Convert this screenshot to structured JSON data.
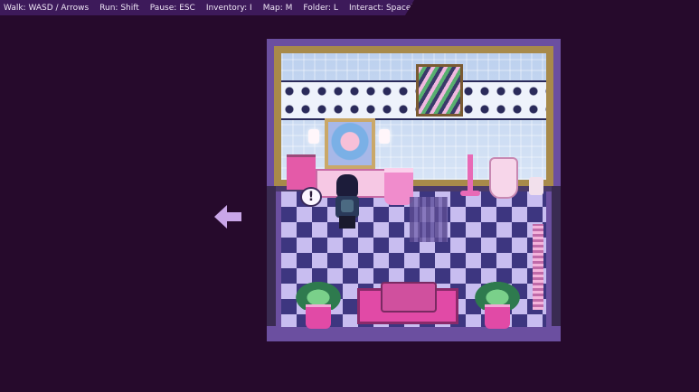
{
  "controls": [
    {
      "label": "Walk: WASD / Arrows"
    },
    {
      "label": "Run: Shift"
    },
    {
      "label": "Pause: ESC"
    },
    {
      "label": "Inventory: I"
    },
    {
      "label": "Map: M"
    },
    {
      "label": "Folder: L"
    },
    {
      "label": "Interact: Spacebar / Enter"
    }
  ],
  "interaction_indicator": "!",
  "icons": [
    "exit-arrow-left-icon",
    "exclamation-icon"
  ],
  "colors": {
    "background": "#260a2c",
    "hint_bar": "#3d1a5a",
    "hint_text": "#efe6f6",
    "room_frame": "#6b4fa0",
    "floor_dark": "#3d3680",
    "floor_light": "#c8bdf0",
    "accent_pink": "#e14aa6",
    "exit_arrow": "#c9a6e8"
  }
}
